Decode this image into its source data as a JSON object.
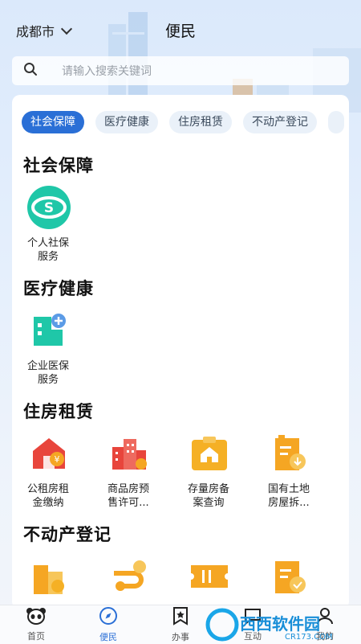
{
  "header": {
    "city": "成都市",
    "title": "便民"
  },
  "search": {
    "placeholder": "请输入搜索关键词"
  },
  "tabs": [
    "社会保障",
    "医疗健康",
    "住房租赁",
    "不动产登记"
  ],
  "sections": [
    {
      "title": "社会保障",
      "items": [
        {
          "label": "个人社保服务",
          "icon": "social-security-icon"
        }
      ]
    },
    {
      "title": "医疗健康",
      "items": [
        {
          "label": "企业医保服务",
          "icon": "medical-insurance-icon"
        }
      ]
    },
    {
      "title": "住房租赁",
      "items": [
        {
          "label": "公租房租金缴纳",
          "icon": "public-housing-rent-icon"
        },
        {
          "label": "商品房预售许可...",
          "icon": "presale-permit-icon"
        },
        {
          "label": "存量房备案查询",
          "icon": "housing-record-icon"
        },
        {
          "label": "国有土地房屋拆...",
          "icon": "land-house-icon"
        }
      ]
    },
    {
      "title": "不动产登记",
      "items": [
        {
          "icon": "property-building-icon"
        },
        {
          "icon": "property-coin-icon"
        },
        {
          "icon": "property-ticket-icon"
        },
        {
          "icon": "property-check-icon"
        }
      ]
    }
  ],
  "navbar": [
    {
      "label": "首页",
      "icon": "panda-home-icon"
    },
    {
      "label": "便民",
      "icon": "compass-icon"
    },
    {
      "label": "办事",
      "icon": "bookmark-star-icon"
    },
    {
      "label": "互动",
      "icon": "chat-icon"
    },
    {
      "label": "我的",
      "icon": "user-icon"
    }
  ],
  "watermark": {
    "brand": "西西软件园",
    "url": "CR173.COM"
  },
  "colors": {
    "accent": "#2a6fd6",
    "orange": "#f5a623",
    "red": "#e8453c",
    "teal": "#1fc7a8"
  }
}
